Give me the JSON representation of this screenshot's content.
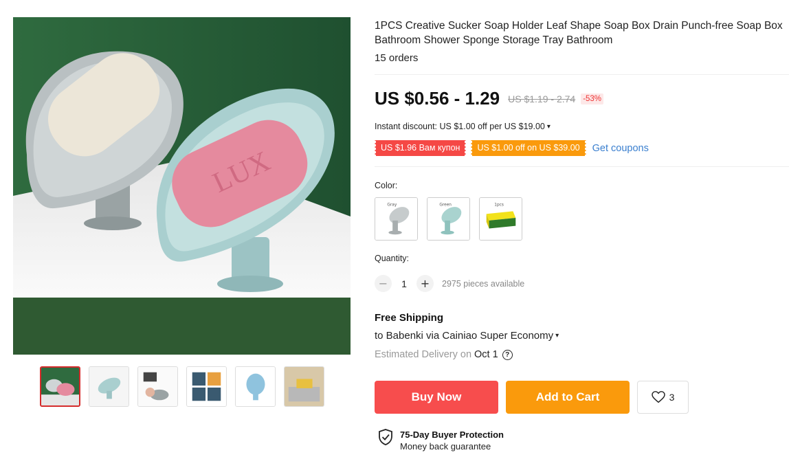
{
  "product": {
    "title": "1PCS Creative Sucker Soap Holder Leaf Shape Soap Box Drain Punch-free Soap Box Bathroom Shower Sponge Storage Tray Bathroom",
    "orders": "15 orders",
    "price": "US $0.56 - 1.29",
    "old_price": "US $1.19 - 2.74",
    "discount": "-53%"
  },
  "promo": {
    "instant_discount": "Instant discount: US $1.00 off per US $19.00",
    "coupon_red": "US $1.96 Вам купон",
    "coupon_orange": "US $1.00 off on US $39.00",
    "get_coupons": "Get coupons"
  },
  "color": {
    "label": "Color:",
    "options": [
      {
        "text": "Gray"
      },
      {
        "text": "Green"
      },
      {
        "text": "1pcs"
      }
    ]
  },
  "quantity": {
    "label": "Quantity:",
    "value": "1",
    "minus": "−",
    "plus": "+",
    "available": "2975 pieces available"
  },
  "shipping": {
    "title": "Free Shipping",
    "to": "to Babenki via Cainiao Super Economy",
    "estimated": "Estimated Delivery on",
    "date": "Oct 1",
    "help": "?"
  },
  "actions": {
    "buy_now": "Buy Now",
    "add_to_cart": "Add to Cart",
    "wishlist_count": "3"
  },
  "protection": {
    "title": "75-Day Buyer Protection",
    "subtitle": "Money back guarantee"
  },
  "colors": {
    "accent_red": "#f74d4d",
    "accent_orange": "#fa9a0c",
    "link_blue": "#3a7fcf",
    "thumb_active": "#d52b2b"
  }
}
